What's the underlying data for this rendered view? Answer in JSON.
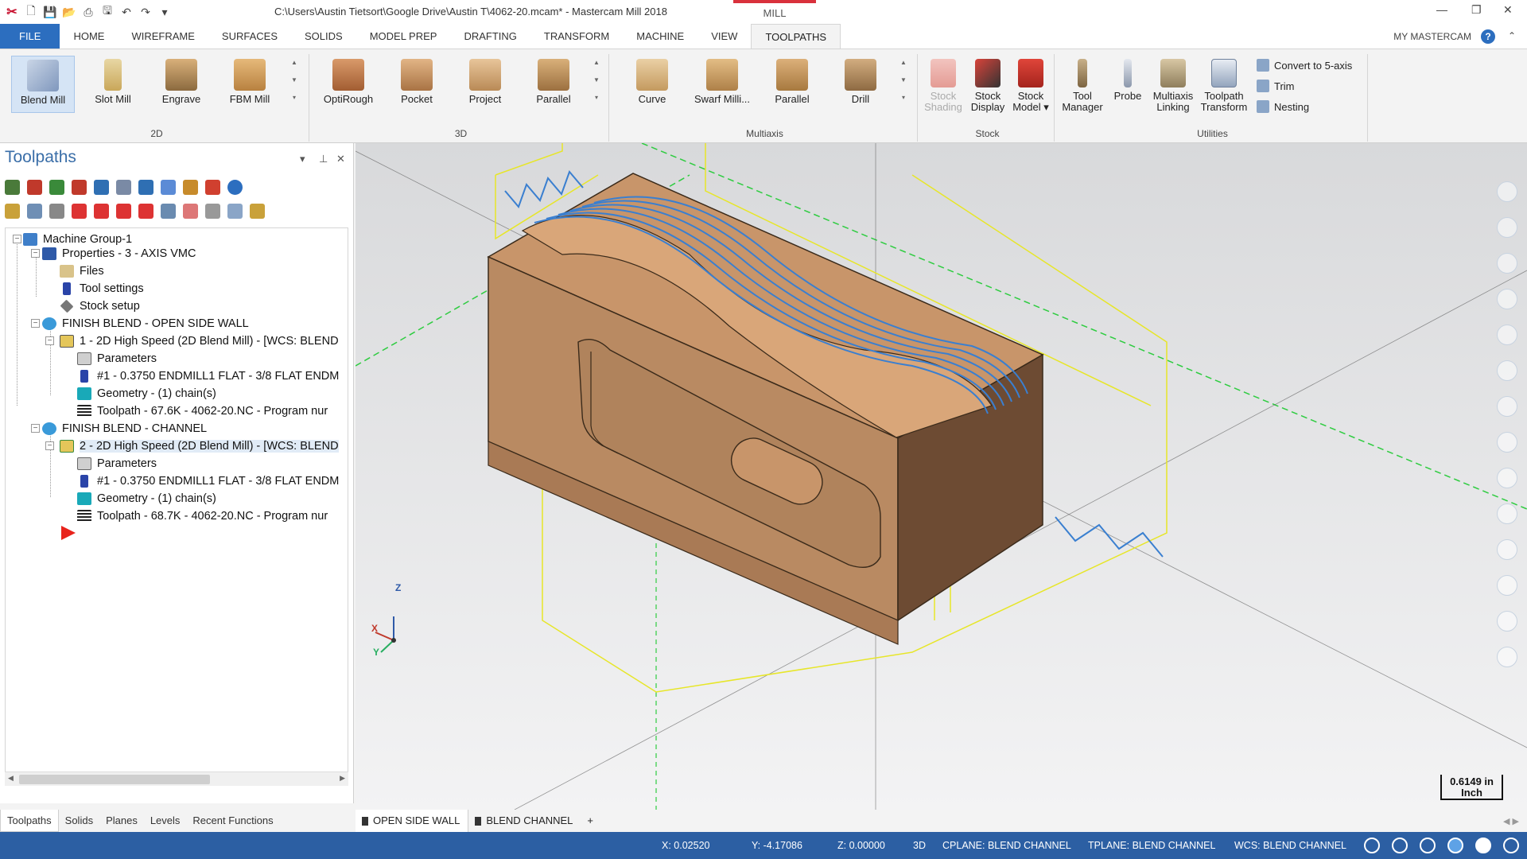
{
  "window": {
    "title": "C:\\Users\\Austin Tietsort\\Google Drive\\Austin T\\4062-20.mcam* - Mastercam Mill 2018",
    "context_tab": "MILL"
  },
  "ribbon_tabs": [
    "FILE",
    "HOME",
    "WIREFRAME",
    "SURFACES",
    "SOLIDS",
    "MODEL PREP",
    "DRAFTING",
    "TRANSFORM",
    "MACHINE",
    "VIEW",
    "TOOLPATHS"
  ],
  "active_ribbon_tab": "TOOLPATHS",
  "account_label": "MY MASTERCAM",
  "help_label": "?",
  "ribbon_groups": {
    "g2d": {
      "label": "2D",
      "buttons": [
        "Blend Mill",
        "Slot Mill",
        "Engrave",
        "FBM Mill"
      ]
    },
    "g3d": {
      "label": "3D",
      "buttons": [
        "OptiRough",
        "Pocket",
        "Project",
        "Parallel"
      ]
    },
    "gmulti": {
      "label": "Multiaxis",
      "buttons": [
        "Curve",
        "Swarf Milli...",
        "Parallel",
        "Drill"
      ]
    },
    "gstock": {
      "label": "Stock",
      "buttons": [
        [
          "Stock",
          "Shading"
        ],
        [
          "Stock",
          "Display"
        ],
        [
          "Stock",
          "Model ▾"
        ]
      ]
    },
    "gutil": {
      "label": "Utilities",
      "buttons": [
        [
          "Tool",
          "Manager"
        ],
        [
          "Probe",
          ""
        ],
        [
          "Multiaxis",
          "Linking"
        ],
        [
          "Toolpath",
          "Transform"
        ]
      ],
      "small": [
        "Convert to 5-axis",
        "Trim",
        "Nesting"
      ]
    }
  },
  "panel": {
    "title": "Toolpaths",
    "tree": [
      "Machine Group-1",
      "Properties - 3 - AXIS VMC",
      "Files",
      "Tool settings",
      "Stock setup",
      "FINISH BLEND - OPEN SIDE WALL",
      "1 - 2D High Speed (2D Blend Mill) - [WCS: BLEND",
      "Parameters",
      "#1 - 0.3750 ENDMILL1 FLAT - 3/8 FLAT ENDM",
      "Geometry -  (1) chain(s)",
      "Toolpath - 67.6K - 4062-20.NC - Program nur",
      "FINISH BLEND - CHANNEL",
      "2 - 2D High Speed (2D Blend Mill) - [WCS: BLEND",
      "Parameters",
      "#1 - 0.3750 ENDMILL1 FLAT - 3/8 FLAT ENDM",
      "Geometry -  (1) chain(s)",
      "Toolpath - 68.7K - 4062-20.NC - Program nur"
    ],
    "bottom_tabs": [
      "Toolpaths",
      "Solids",
      "Planes",
      "Levels",
      "Recent Functions"
    ]
  },
  "viewport": {
    "scale_value": "0.6149 in",
    "scale_unit": "Inch",
    "axis_labels": {
      "x": "X",
      "y": "Y",
      "z": "Z"
    },
    "view_tabs": [
      "OPEN SIDE WALL",
      "BLEND CHANNEL"
    ],
    "add_tab": "+"
  },
  "status": {
    "x": "X:  0.02520",
    "y": "Y:  -4.17086",
    "z": "Z:  0.00000",
    "mode": "3D",
    "cplane": "CPLANE: BLEND CHANNEL",
    "tplane": "TPLANE: BLEND CHANNEL",
    "wcs": "WCS: BLEND CHANNEL"
  },
  "colors": {
    "accent": "#2c6ebf",
    "status": "#2c5fa3",
    "part": "#c8946a",
    "toolpath": "#3a7fd0",
    "wire": "#e7e628"
  }
}
